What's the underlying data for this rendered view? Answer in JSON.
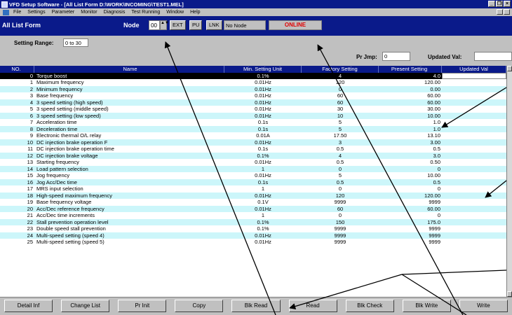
{
  "window": {
    "title": "VFD Setup Software - [All List Form D:\\WORK\\INCOMING\\TEST1.MEL]",
    "minimize_glyph": "_",
    "restore_glyph": "❐",
    "close_glyph": "×"
  },
  "menu": [
    "File",
    "Settings",
    "Parameter",
    "Monitor",
    "Diagnosis",
    "Test Running",
    "Window",
    "Help"
  ],
  "form": {
    "title": "All List Form",
    "node_label": "Node",
    "node_value": "00",
    "spin_glyph": "▲▼",
    "ext_label": "EXT",
    "pu_label": "PU",
    "lnk_label": "LNK",
    "node_status": "No Node",
    "online_label": "ONLINE",
    "online_color": "#e00000"
  },
  "panel": {
    "setting_range_label": "Setting Range:",
    "setting_range_value": "0 to 30",
    "pr_jmp_label": "Pr Jmp:",
    "pr_jmp_value": "0",
    "updated_val_label": "Updated Val:"
  },
  "table": {
    "headers": [
      "NO.",
      "Name",
      "Min. Setting Unit",
      "Factory Setting",
      "Present Setting",
      "Updated Val"
    ],
    "rows": [
      [
        "0",
        "Torque boost",
        "0.1%",
        "4",
        "4.0"
      ],
      [
        "1",
        "Maximum frequency",
        "0.01Hz",
        "120",
        "120.00"
      ],
      [
        "2",
        "Minimum frequency",
        "0.01Hz",
        "0",
        "0.00"
      ],
      [
        "3",
        "Base frequency",
        "0.01Hz",
        "60",
        "60.00"
      ],
      [
        "4",
        "3 speed setting (high speed)",
        "0.01Hz",
        "60",
        "60.00"
      ],
      [
        "5",
        "3 speed setting (middle speed)",
        "0.01Hz",
        "30",
        "30.00"
      ],
      [
        "6",
        "3 speed setting (low speed)",
        "0.01Hz",
        "10",
        "10.00"
      ],
      [
        "7",
        "Acceleration time",
        "0.1s",
        "5",
        "1.0"
      ],
      [
        "8",
        "Deceleration time",
        "0.1s",
        "5",
        "1.0"
      ],
      [
        "9",
        "Electronic thermal O/L relay",
        "0.01A",
        "17.50",
        "13.10"
      ],
      [
        "10",
        "DC injection brake operation F",
        "0.01Hz",
        "3",
        "3.00"
      ],
      [
        "11",
        "DC injection brake operation time",
        "0.1s",
        "0.5",
        "0.5"
      ],
      [
        "12",
        "DC injection brake voltage",
        "0.1%",
        "4",
        "3.0"
      ],
      [
        "13",
        "Starting frequency",
        "0.01Hz",
        "0.5",
        "0.50"
      ],
      [
        "14",
        "Load pattern selection",
        "1",
        "0",
        "0"
      ],
      [
        "15",
        "Jog frequency",
        "0.01Hz",
        "5",
        "10.00"
      ],
      [
        "16",
        "Jog Acc/Dec time",
        "0.1s",
        "0.5",
        "0.5"
      ],
      [
        "17",
        "MRS input selection",
        "1",
        "0",
        "0"
      ],
      [
        "18",
        "High-speed maximum frequency",
        "0.01Hz",
        "120",
        "120.00"
      ],
      [
        "19",
        "Base frequency voltage",
        "0.1V",
        "9999",
        "9999"
      ],
      [
        "20",
        "Acc/Dec reference frequency",
        "0.01Hz",
        "60",
        "60.00"
      ],
      [
        "21",
        "Acc/Dec time increments",
        "1",
        "0",
        "0"
      ],
      [
        "22",
        "Stall prevention operation level",
        "0.1%",
        "150",
        "175.0"
      ],
      [
        "23",
        "Double speed stall prevention",
        "0.1%",
        "9999",
        "9999"
      ],
      [
        "24",
        "Multi-speed setting (speed 4)",
        "0.01Hz",
        "9999",
        "9999"
      ],
      [
        "25",
        "Multi-speed setting (speed 5)",
        "0.01Hz",
        "9999",
        "9999"
      ]
    ]
  },
  "buttons": [
    "Detail Inf",
    "Change List",
    "Pr Init",
    "Copy",
    "Blk Read",
    "Read",
    "Blk Check",
    "Blk Write",
    "Write"
  ],
  "colors": {
    "title_bar": "#0a1a8a",
    "row_alt": "#ccf6fa",
    "selected_row": "#000000"
  }
}
